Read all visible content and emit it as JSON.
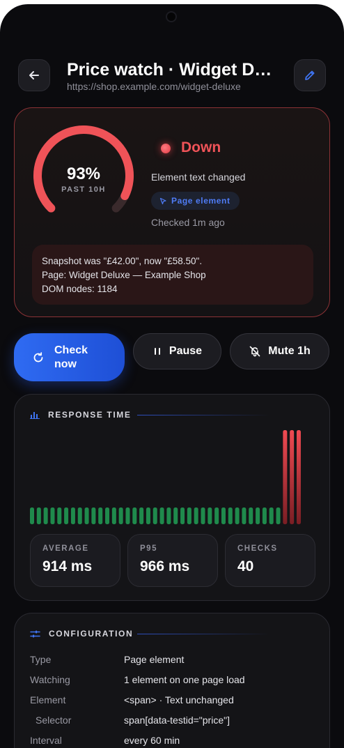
{
  "header": {
    "title": "Price watch · Widget Deluxe",
    "url": "https://shop.example.com/widget-deluxe"
  },
  "uptime": {
    "percent_label": "93%",
    "percent_value": 93,
    "window_label": "PAST 10H",
    "status": "Down",
    "reason": "Element text changed",
    "chip_label": "Page element",
    "checked": "Checked 1m ago",
    "snapshot_lines": [
      "Snapshot was \"£42.00\", now \"£58.50\".",
      "Page: Widget Deluxe — Example Shop",
      "DOM nodes: 1184"
    ],
    "colors": {
      "down": "#ef5358",
      "accent": "#2f6bf2"
    }
  },
  "actions": {
    "check_now": "Check now",
    "pause": "Pause",
    "mute": "Mute 1h"
  },
  "response": {
    "heading": "RESPONSE TIME",
    "bars": {
      "count": 40,
      "ok_count": 37,
      "failed_count": 3,
      "ok_color": "#1f8a4c",
      "fail_color": "#e04048"
    },
    "stats": [
      {
        "label": "AVERAGE",
        "value": "914 ms"
      },
      {
        "label": "P95",
        "value": "966 ms"
      },
      {
        "label": "CHECKS",
        "value": "40"
      }
    ]
  },
  "config": {
    "heading": "CONFIGURATION",
    "rows": [
      {
        "key": "Type",
        "value": "Page element"
      },
      {
        "key": "Watching",
        "value": "1 element on one page load"
      },
      {
        "key": "Element",
        "value": "<span> · Text unchanged"
      },
      {
        "key": "Selector",
        "value": "span[data-testid=\"price\"]"
      },
      {
        "key": "Interval",
        "value": "every 60 min"
      }
    ]
  }
}
